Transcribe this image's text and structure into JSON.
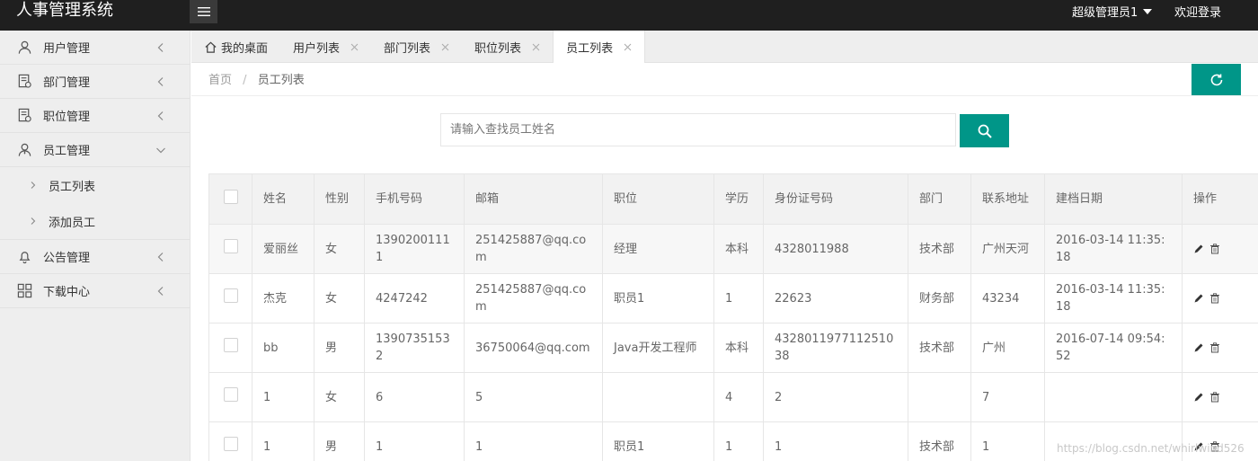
{
  "app": {
    "title": "人事管理系统",
    "user_label": "超级管理员1",
    "logout_label": "欢迎登录"
  },
  "sidebar": {
    "items": [
      {
        "label": "用户管理",
        "icon": "user-icon"
      },
      {
        "label": "部门管理",
        "icon": "department-icon"
      },
      {
        "label": "职位管理",
        "icon": "position-icon"
      },
      {
        "label": "员工管理",
        "icon": "employee-icon",
        "expanded": true,
        "children": [
          {
            "label": "员工列表"
          },
          {
            "label": "添加员工"
          }
        ]
      },
      {
        "label": "公告管理",
        "icon": "announcement-icon"
      },
      {
        "label": "下载中心",
        "icon": "download-center-icon"
      }
    ]
  },
  "tabs": [
    {
      "label": "我的桌面",
      "icon": "home-icon",
      "closable": false
    },
    {
      "label": "用户列表",
      "closable": true
    },
    {
      "label": "部门列表",
      "closable": true
    },
    {
      "label": "职位列表",
      "closable": true
    },
    {
      "label": "员工列表",
      "closable": true,
      "active": true
    }
  ],
  "breadcrumb": {
    "home": "首页",
    "separator": "/",
    "current": "员工列表"
  },
  "search": {
    "placeholder": "请输入查找员工姓名",
    "value": ""
  },
  "table": {
    "columns": [
      "姓名",
      "性别",
      "手机号码",
      "邮箱",
      "职位",
      "学历",
      "身份证号码",
      "部门",
      "联系地址",
      "建档日期",
      "操作"
    ],
    "rows": [
      {
        "name": "爱丽丝",
        "gender": "女",
        "phone": "13902001111",
        "email": "251425887@qq.com",
        "position": "经理",
        "education": "本科",
        "id_card": "4328011988",
        "department": "技术部",
        "address": "广州天河",
        "created": "2016-03-14 11:35:18"
      },
      {
        "name": "杰克",
        "gender": "女",
        "phone": "4247242",
        "email": "251425887@qq.com",
        "position": "职员1",
        "education": "1",
        "id_card": "22623",
        "department": "财务部",
        "address": "43234",
        "created": "2016-03-14 11:35:18"
      },
      {
        "name": "bb",
        "gender": "男",
        "phone": "13907351532",
        "email": "36750064@qq.com",
        "position": "Java开发工程师",
        "education": "本科",
        "id_card": "432801197711251038",
        "department": "技术部",
        "address": "广州",
        "created": "2016-07-14 09:54:52"
      },
      {
        "name": "1",
        "gender": "女",
        "phone": "6",
        "email": "5",
        "position": "",
        "education": "4",
        "id_card": "2",
        "department": "",
        "address": "7",
        "created": ""
      },
      {
        "name": "1",
        "gender": "男",
        "phone": "1",
        "email": "1",
        "position": "职员1",
        "education": "1",
        "id_card": "1",
        "department": "技术部",
        "address": "1",
        "created": ""
      }
    ]
  },
  "colors": {
    "header_bg": "#1f1f1f",
    "accent": "#009688",
    "sidebar_bg": "#eeeeee"
  },
  "watermark": "https://blog.csdn.net/whirlwind526"
}
